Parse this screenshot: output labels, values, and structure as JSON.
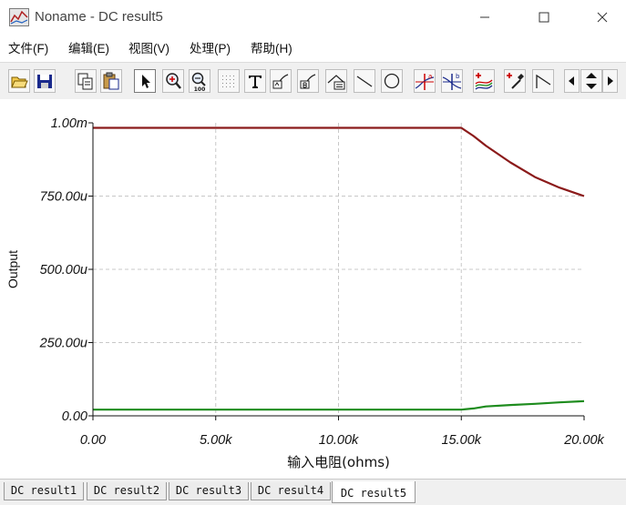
{
  "window": {
    "title": "Noname - DC result5"
  },
  "menu": [
    {
      "label": "文件(F)"
    },
    {
      "label": "编辑(E)"
    },
    {
      "label": "视图(V)"
    },
    {
      "label": "处理(P)"
    },
    {
      "label": "帮助(H)"
    }
  ],
  "toolbar": {
    "icons": [
      "open-icon",
      "save-icon",
      "copy-icon",
      "paste-icon",
      "pointer-icon",
      "zoom-in-icon",
      "zoom-100-icon",
      "grid-icon",
      "text-icon",
      "cursor-a-icon",
      "cursor-b-icon",
      "cursor-ab-icon",
      "line-icon",
      "circle-icon",
      "marker-a-icon",
      "marker-b-icon",
      "curve-add-icon",
      "color-pick-icon",
      "polyline-icon"
    ],
    "zoom_label": "100"
  },
  "tabs": [
    {
      "label": "DC result1"
    },
    {
      "label": "DC result2"
    },
    {
      "label": "DC result3"
    },
    {
      "label": "DC result4"
    },
    {
      "label": "DC result5",
      "active": true
    }
  ],
  "colors": {
    "series_red": "#8b1a1a",
    "series_green": "#1e8c1e",
    "grid": "#c8c8c8"
  },
  "chart_data": {
    "type": "line",
    "xlabel": "输入电阻(ohms)",
    "ylabel": "Output",
    "x_ticks": [
      "0.00",
      "5.00k",
      "10.00k",
      "15.00k",
      "20.00k"
    ],
    "y_ticks": [
      "0.00",
      "250.00u",
      "500.00u",
      "750.00u",
      "1.00m"
    ],
    "xlim": [
      0,
      20000
    ],
    "ylim": [
      0,
      0.001
    ],
    "grid": true,
    "series": [
      {
        "color": "#8b1a1a",
        "x": [
          0,
          15000,
          15500,
          16000,
          17000,
          18000,
          19000,
          20000
        ],
        "y": [
          0.000983,
          0.000983,
          0.000955,
          0.000922,
          0.000865,
          0.000815,
          0.000779,
          0.00075
        ]
      },
      {
        "color": "#1e8c1e",
        "x": [
          0,
          15000,
          15500,
          16000,
          17000,
          18000,
          19000,
          20000
        ],
        "y": [
          2.1e-05,
          2.1e-05,
          2.5e-05,
          3.2e-05,
          3.7e-05,
          4.1e-05,
          4.6e-05,
          5e-05
        ]
      }
    ]
  }
}
